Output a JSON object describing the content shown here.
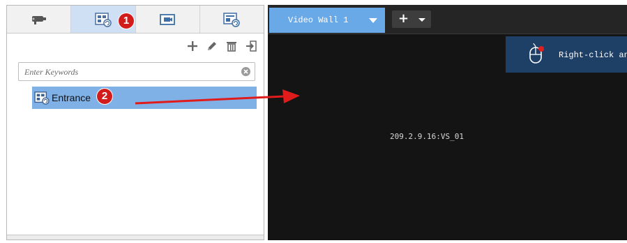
{
  "left_panel": {
    "tabs": [
      {
        "name": "camera-tab",
        "icon": "camera-icon"
      },
      {
        "name": "video-wall-view-tab",
        "icon": "video-wall-view-icon",
        "active": true
      },
      {
        "name": "screen-tab",
        "icon": "screen-icon"
      },
      {
        "name": "wall-config-tab",
        "icon": "wall-config-icon"
      }
    ],
    "toolbar": [
      "add-icon",
      "edit-icon",
      "delete-icon",
      "import-icon"
    ],
    "search": {
      "placeholder": "Enter Keywords",
      "value": ""
    },
    "tree": [
      {
        "label": "Entrance",
        "icon": "video-wall-view-icon",
        "selected": true
      }
    ]
  },
  "right_panel": {
    "wall_tab": {
      "label": "Video Wall 1"
    },
    "add_button": {
      "symbol": "+"
    },
    "tooltip": {
      "text": "Right-click an"
    },
    "window_label": "209.2.9.16:VS_01"
  },
  "annotations": {
    "badge_1": "1",
    "badge_2": "2",
    "arrow_color": "#e01b1b"
  },
  "colors": {
    "selected": "#7fb0e6",
    "active_tab": "#cfe0f4",
    "wall_tab": "#6aa9e8",
    "wall_bg": "#141414",
    "badge": "#d21c1c",
    "tooltip_bg": "#1e3f66"
  }
}
